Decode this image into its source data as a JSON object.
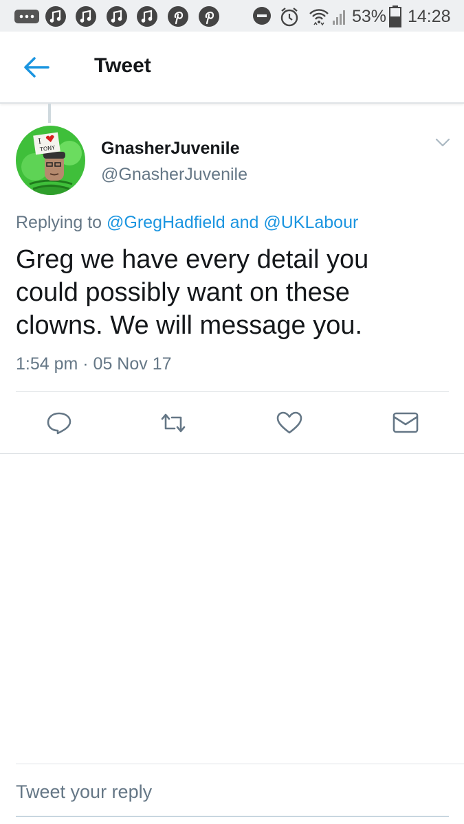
{
  "status_bar": {
    "battery_percent": "53%",
    "battery_level": 0.53,
    "time": "14:28",
    "left_icons": [
      "more-icon",
      "music-note-icon",
      "music-note-icon",
      "music-note-icon",
      "music-note-icon",
      "pinterest-icon",
      "pinterest-icon"
    ],
    "right_icons": [
      "do-not-disturb-icon",
      "alarm-icon",
      "wifi-icon",
      "signal-icon",
      "battery-icon"
    ]
  },
  "header": {
    "back_icon": "arrow-left-icon",
    "title": "Tweet"
  },
  "tweet": {
    "display_name": "GnasherJuvenile",
    "handle": "@GnasherJuvenile",
    "avatar_sign_line1": "I",
    "avatar_sign_line2": "TONY",
    "replying_prefix": "Replying to",
    "mention_1": "@GregHadfield",
    "mention_connector": "and",
    "mention_2": "@UKLabour",
    "text": "Greg we have every detail you could possibly want on these clowns. We will message you.",
    "timestamp": "1:54 pm · 05 Nov 17",
    "actions": [
      "reply-icon",
      "retweet-icon",
      "like-icon",
      "direct-message-icon"
    ]
  },
  "reply_bar": {
    "placeholder": "Tweet your reply"
  },
  "colors": {
    "accent": "#1b95e0",
    "text_primary": "#14171a",
    "text_secondary": "#657786",
    "divider": "#dfe3e6",
    "status_bar_bg": "#eef0f2",
    "avatar_green": "#3fbf3a"
  }
}
